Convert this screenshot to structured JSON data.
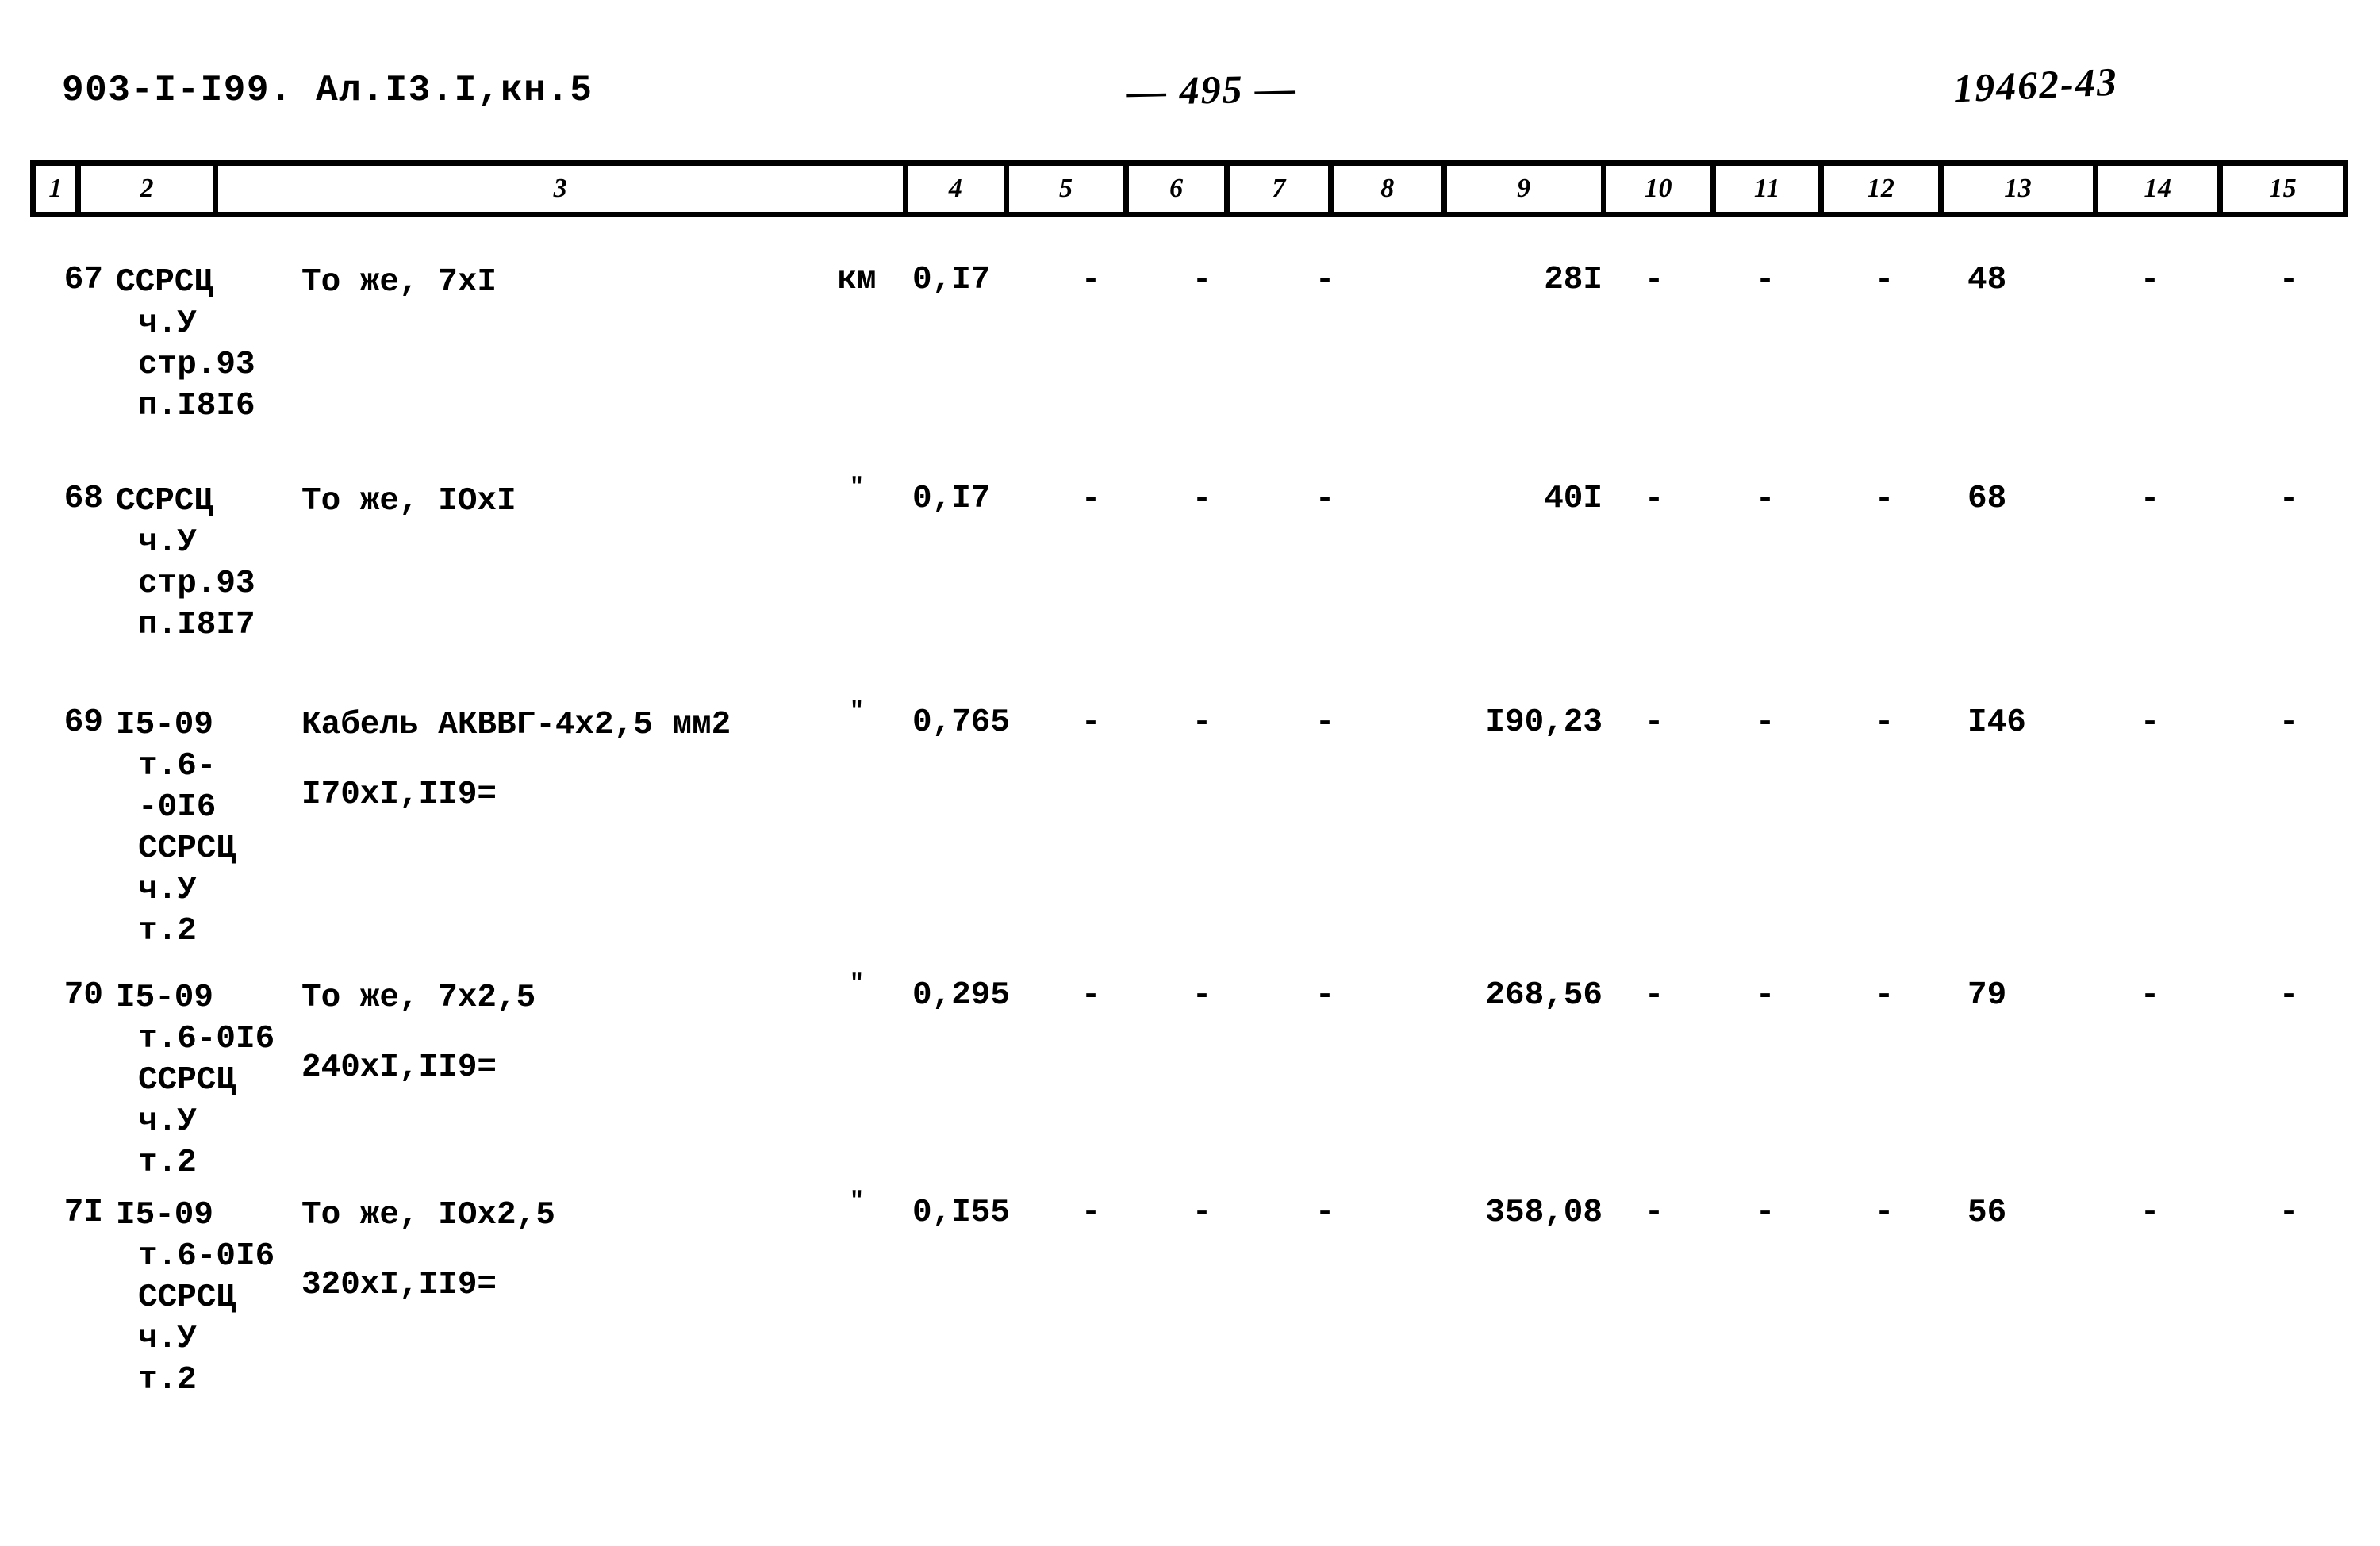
{
  "header": {
    "doc_code": "903-I-I99. Ал.I3.I,кн.5",
    "page_number": "— 495 —",
    "stamp_number": "19462-43"
  },
  "table": {
    "column_numbers": [
      "1",
      "2",
      "3",
      "4",
      "5",
      "6",
      "7",
      "8",
      "9",
      "10",
      "11",
      "12",
      "13",
      "14",
      "15"
    ],
    "rows": [
      {
        "num": "67",
        "code_lines": [
          "ССРСЦ",
          "ч.У",
          "стр.93",
          "п.I8I6"
        ],
        "desc_lines": [
          "То же, 7хI"
        ],
        "unit": "км",
        "qty": "0,I7",
        "c6": "-",
        "c7": "-",
        "c8": "-",
        "c9": "28I",
        "c10": "-",
        "c11": "-",
        "c12": "-",
        "c13": "48",
        "c14": "-",
        "c15": "-"
      },
      {
        "num": "68",
        "code_lines": [
          "ССРСЦ",
          "ч.У",
          "стр.93",
          "п.I8I7"
        ],
        "desc_lines": [
          "То же, IОхI"
        ],
        "unit": "\"",
        "qty": "0,I7",
        "c6": "-",
        "c7": "-",
        "c8": "-",
        "c9": "40I",
        "c10": "-",
        "c11": "-",
        "c12": "-",
        "c13": "68",
        "c14": "-",
        "c15": "-"
      },
      {
        "num": "69",
        "code_lines": [
          "I5-09",
          "т.6-",
          "-0I6",
          "ССРСЦ",
          "ч.У",
          "т.2"
        ],
        "desc_lines": [
          "Кабель АКВВГ-4х2,5 мм2",
          "I70хI,II9="
        ],
        "unit": "\"",
        "qty": "0,765",
        "c6": "-",
        "c7": "-",
        "c8": "-",
        "c9": "I90,23",
        "c10": "-",
        "c11": "-",
        "c12": "-",
        "c13": "I46",
        "c14": "-",
        "c15": "-"
      },
      {
        "num": "70",
        "code_lines": [
          "I5-09",
          "т.6-0I6",
          "ССРСЦ",
          "ч.У",
          "т.2"
        ],
        "desc_lines": [
          "То же, 7х2,5",
          "240хI,II9="
        ],
        "unit": "\"",
        "qty": "0,295",
        "c6": "-",
        "c7": "-",
        "c8": "-",
        "c9": "268,56",
        "c10": "-",
        "c11": "-",
        "c12": "-",
        "c13": "79",
        "c14": "-",
        "c15": "-"
      },
      {
        "num": "7I",
        "code_lines": [
          "I5-09",
          "т.6-0I6",
          "ССРСЦ",
          "ч.У",
          "т.2"
        ],
        "desc_lines": [
          "То же, IОх2,5",
          "320хI,II9="
        ],
        "unit": "\"",
        "qty": "0,I55",
        "c6": "-",
        "c7": "-",
        "c8": "-",
        "c9": "358,08",
        "c10": "-",
        "c11": "-",
        "c12": "-",
        "c13": "56",
        "c14": "-",
        "c15": "-"
      }
    ]
  }
}
